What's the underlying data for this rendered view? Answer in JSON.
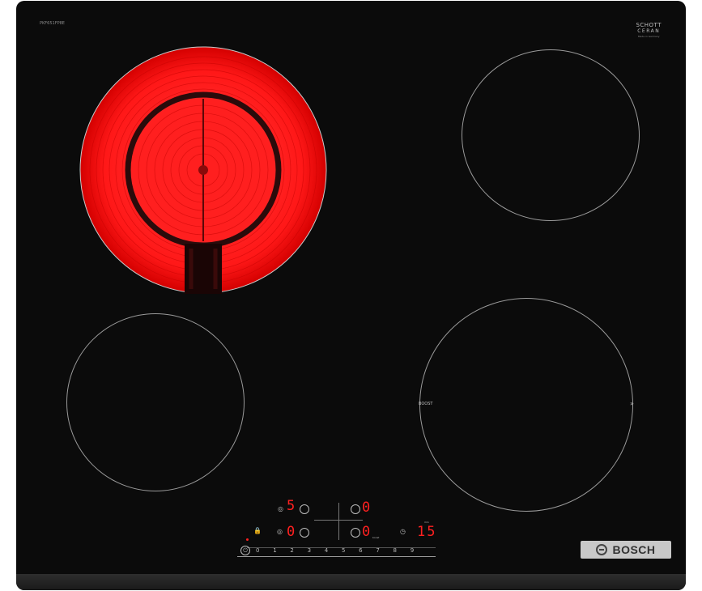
{
  "device": {
    "model_code": "PKF651FP8E",
    "glass_brand_line1": "SCHOTT",
    "glass_brand_line2": "CERAN",
    "glass_brand_line3": "Made in Germany",
    "brand": "BOSCH"
  },
  "zones": {
    "front_right_label": "BOOST",
    "front_right_chevron": "»"
  },
  "panel": {
    "rear_left_level": "5",
    "rear_right_level": "0",
    "front_left_level": "0",
    "front_right_level": "0",
    "timer_value": "15",
    "timer_unit": "min",
    "boost_small": "boost",
    "scale": [
      "0",
      "1",
      "2",
      "3",
      "4",
      "5",
      "6",
      "7",
      "8",
      "9"
    ],
    "power_icon": "power-icon",
    "lock_icon": "child-lock-icon",
    "timer_icon": "clock-icon"
  },
  "colors": {
    "glass": "#0b0b0b",
    "heat": "#ff2020",
    "print": "#bdbdbd"
  }
}
